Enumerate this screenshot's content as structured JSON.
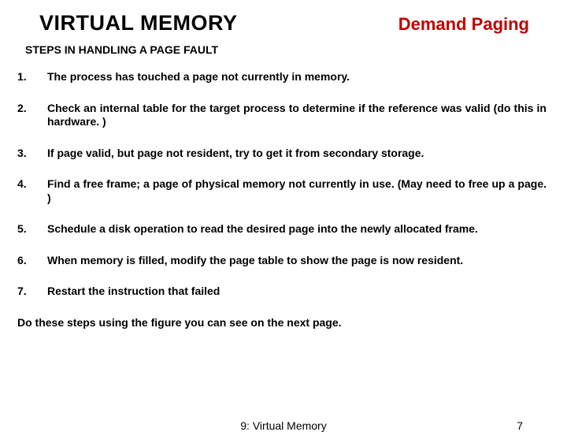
{
  "header": {
    "title": "VIRTUAL MEMORY",
    "subtitle": "Demand Paging"
  },
  "section_heading": "STEPS IN HANDLING A PAGE FAULT",
  "steps": [
    {
      "num": "1.",
      "text": "The process has touched a page not currently in memory."
    },
    {
      "num": "2.",
      "text": "Check an internal table for the target process to determine if the reference was valid (do this in hardware. )"
    },
    {
      "num": "3.",
      "text": "If page valid, but page not resident, try to get it from secondary storage."
    },
    {
      "num": "4.",
      "text": "Find a free frame; a page of physical memory not currently in use. (May need to free up a page. )"
    },
    {
      "num": "5.",
      "text": "Schedule a disk operation to read the desired page into the newly allocated frame."
    },
    {
      "num": "6.",
      "text": "When memory is filled, modify the page table to show the page is now resident."
    },
    {
      "num": "7.",
      "text": "Restart the instruction that failed"
    }
  ],
  "closing": "Do these steps using the figure you can see on the next page.",
  "footer": {
    "center": "9: Virtual Memory",
    "page": "7"
  }
}
